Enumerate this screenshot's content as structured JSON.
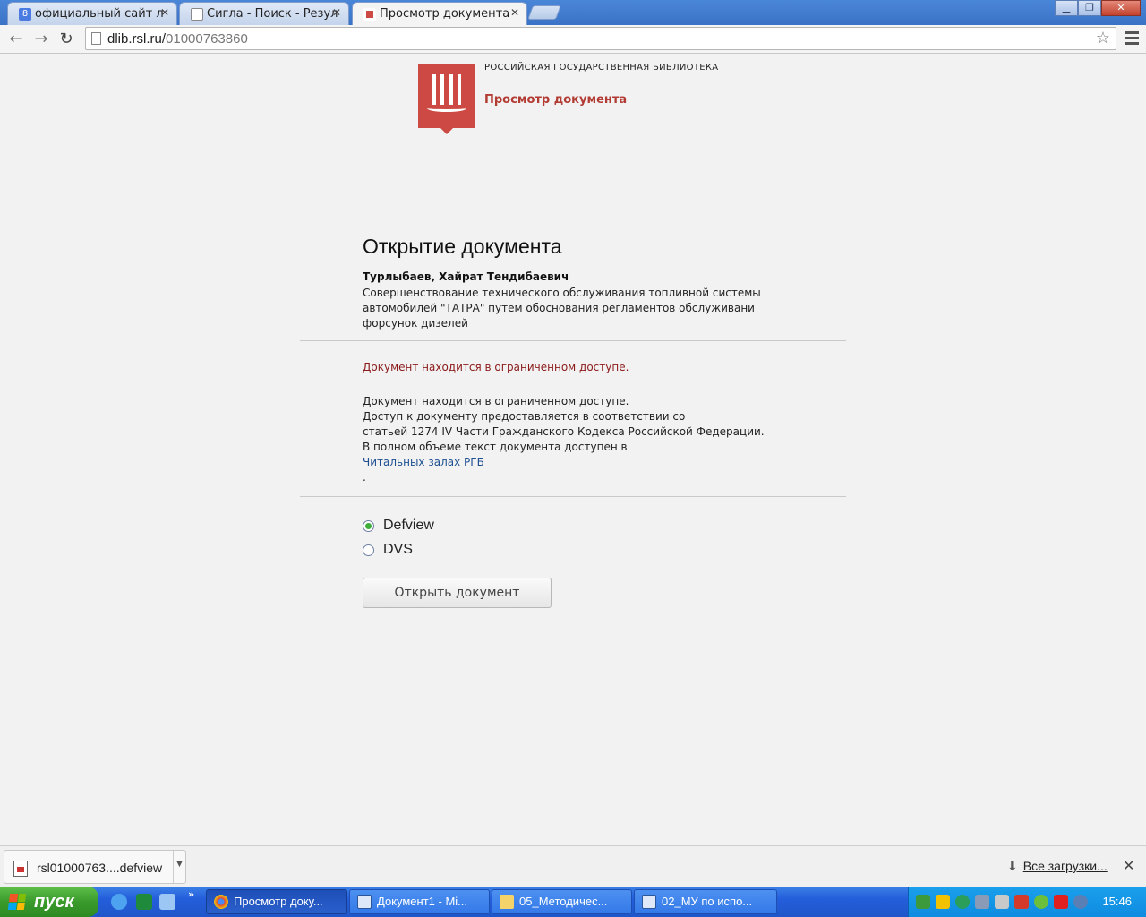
{
  "browser": {
    "tabs": [
      {
        "label": "официальный сайт л",
        "favicon": "google-g-icon"
      },
      {
        "label": "Сигла - Поиск - Резул",
        "favicon": "page-icon"
      },
      {
        "label": "Просмотр документа",
        "favicon": "rsl-icon"
      }
    ],
    "url_host": "dlib.rsl.ru/",
    "url_path": "01000763860",
    "window_buttons": {
      "minimize": "▁",
      "restore": "❐",
      "close": "✕"
    }
  },
  "header": {
    "library_name": "РОССИЙСКАЯ ГОСУДАРСТВЕННАЯ БИБЛИОТЕКА",
    "view_title": "Просмотр документа"
  },
  "document": {
    "heading": "Открытие документа",
    "author": "Турлыбаев, Хайрат Тендибаевич",
    "title_lines": [
      "Совершенствование технического обслуживания топливной системы",
      "автомобилей \"ТАТРА\" путем обоснования регламентов обслуживани",
      "форсунок дизелей"
    ],
    "restricted_warning": "Документ находится в ограниченном доступе.",
    "notice_lines": [
      "Документ находится в ограниченном доступе.",
      "Доступ к документу предоставляется в соответствии со",
      "статьей 1274 IV Части Гражданского Кодекса Российской Федерации.",
      "В полном объеме текст документа доступен в "
    ],
    "reading_rooms_link": "Читальных залах РГБ",
    "notice_end": ".",
    "viewer_options": [
      {
        "label": "Defview",
        "checked": true
      },
      {
        "label": "DVS",
        "checked": false
      }
    ],
    "open_button": "Открыть документ"
  },
  "downloads": {
    "file_name": "rsl01000763....defview",
    "all_downloads": "Все загрузки..."
  },
  "taskbar": {
    "start_label": "пуск",
    "tasks": [
      {
        "label": "Просмотр доку...",
        "icon": "chrome-icon"
      },
      {
        "label": "Документ1 - Mi...",
        "icon": "word-icon"
      },
      {
        "label": "05_Методичес...",
        "icon": "folder-icon"
      },
      {
        "label": "02_МУ по испо...",
        "icon": "word-icon"
      }
    ],
    "clock": "15:46"
  },
  "colors": {
    "brand_red": "#cc4a43",
    "warning_text": "#8b1a1a",
    "link": "#1d4f91",
    "radio_checked": "#3fae3a"
  }
}
